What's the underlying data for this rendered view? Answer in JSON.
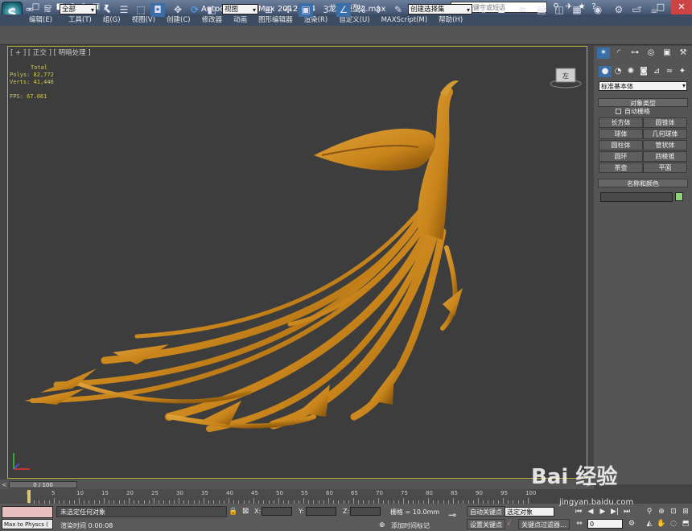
{
  "titlebar": {
    "app_title": "Autodesk 3ds Max  2012 x64",
    "file_name": "龙凤模型2.max",
    "search_placeholder": "键入关键字或短语"
  },
  "menu": [
    "编辑(E)",
    "工具(T)",
    "组(G)",
    "视图(V)",
    "创建(C)",
    "修改器",
    "动画",
    "图形编辑器",
    "渲染(R)",
    "自定义(U)",
    "MAXScript(M)",
    "帮助(H)"
  ],
  "toolbar": {
    "filter_select": "全部",
    "coord_select": "视图",
    "named_selection": "创建选择集",
    "snap_label": "3"
  },
  "viewport": {
    "label": "[ + ] [ 正交 ] [ 明暗处理 ]",
    "stats": {
      "total_label": "Total",
      "polys_label": "Polys:",
      "polys_value": "82,772",
      "verts_label": "Verts:",
      "verts_value": "41,446",
      "fps_label": "FPS:",
      "fps_value": "67.061"
    },
    "viewcube_label": "左"
  },
  "command_panel": {
    "type_select": "标准基本体",
    "object_type_title": "对象类型",
    "auto_grid": "自动栅格",
    "buttons": [
      "长方体",
      "圆锥体",
      "球体",
      "几何球体",
      "圆柱体",
      "管状体",
      "圆环",
      "四棱锥",
      "茶壶",
      "平面"
    ],
    "name_color_title": "名称和颜色"
  },
  "timeline": {
    "slider_label": "0 / 100",
    "ticks": [
      0,
      5,
      10,
      15,
      20,
      25,
      30,
      35,
      40,
      45,
      50,
      55,
      60,
      65,
      70,
      75,
      80,
      85,
      90,
      95,
      100
    ]
  },
  "status": {
    "maxscript": "Max to Physcs (",
    "selection": "未选定任何对象",
    "render_time": "渲染时间  0:00:08",
    "x_label": "X:",
    "y_label": "Y:",
    "z_label": "Z:",
    "grid": "栅格 = 10.0mm",
    "add_time_tag": "添加时间标记",
    "auto_key": "自动关键点",
    "set_key": "设置关键点",
    "selected_object": "选定对象",
    "key_filters": "关键点过滤器...",
    "frame": "0"
  },
  "watermark": {
    "brand": "Bai 经验",
    "url": "jingyan.baidu.com"
  },
  "colors": {
    "model": "#c8841a",
    "viewport_border": "#c0b040",
    "stats_text": "#d6c84a"
  }
}
